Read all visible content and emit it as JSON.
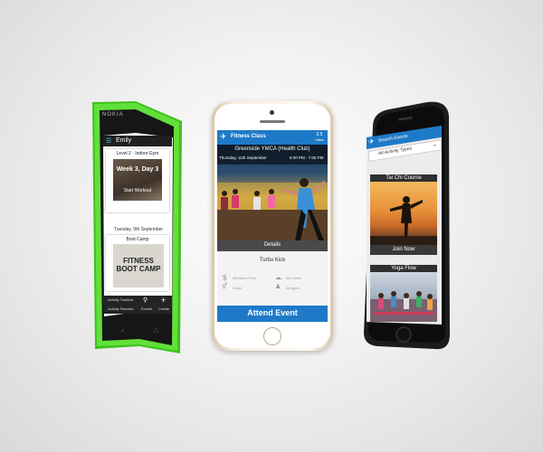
{
  "left_phone": {
    "brand": "NOKIA",
    "app_title": "Emily",
    "card1": {
      "header": "Level 2 · Indoor Gym",
      "week_label": "Week 3, Day 3",
      "image_text": "Start Workout"
    },
    "date_row": "Tuesday, 9th September",
    "card2": {
      "header": "Boot Camp",
      "image_text": "FITNESS BOOT CAMP"
    },
    "bottom_tabs": [
      "Activity Tracked",
      "Events",
      "Create"
    ],
    "bottom_sub": "Activity Planned"
  },
  "center_phone": {
    "header_title": "Fitness Class",
    "header_badge_top": "3.5",
    "header_badge_bottom": "miles",
    "venue": "Greenside YMCA (Health Club)",
    "date": "Thursday, 11th September",
    "time": "6:00 PM - 7:00 PM",
    "details_label": "Details",
    "class_name": "Turbo Kick",
    "info": {
      "price": "Members Free",
      "level": "All Levels",
      "gender": "Coed",
      "ages": "All Ages"
    },
    "attend_button": "Attend Event"
  },
  "right_phone": {
    "header_title": "Search Events",
    "filter_label": "All Activity Types",
    "card1_title": "Tai Chi Course",
    "card1_button": "Join Now",
    "card2_title": "Yoga Flow"
  },
  "colors": {
    "accent_blue": "#1e7ac8",
    "green_phone": "#57d62a",
    "dark_header": "#2f2f2f"
  }
}
